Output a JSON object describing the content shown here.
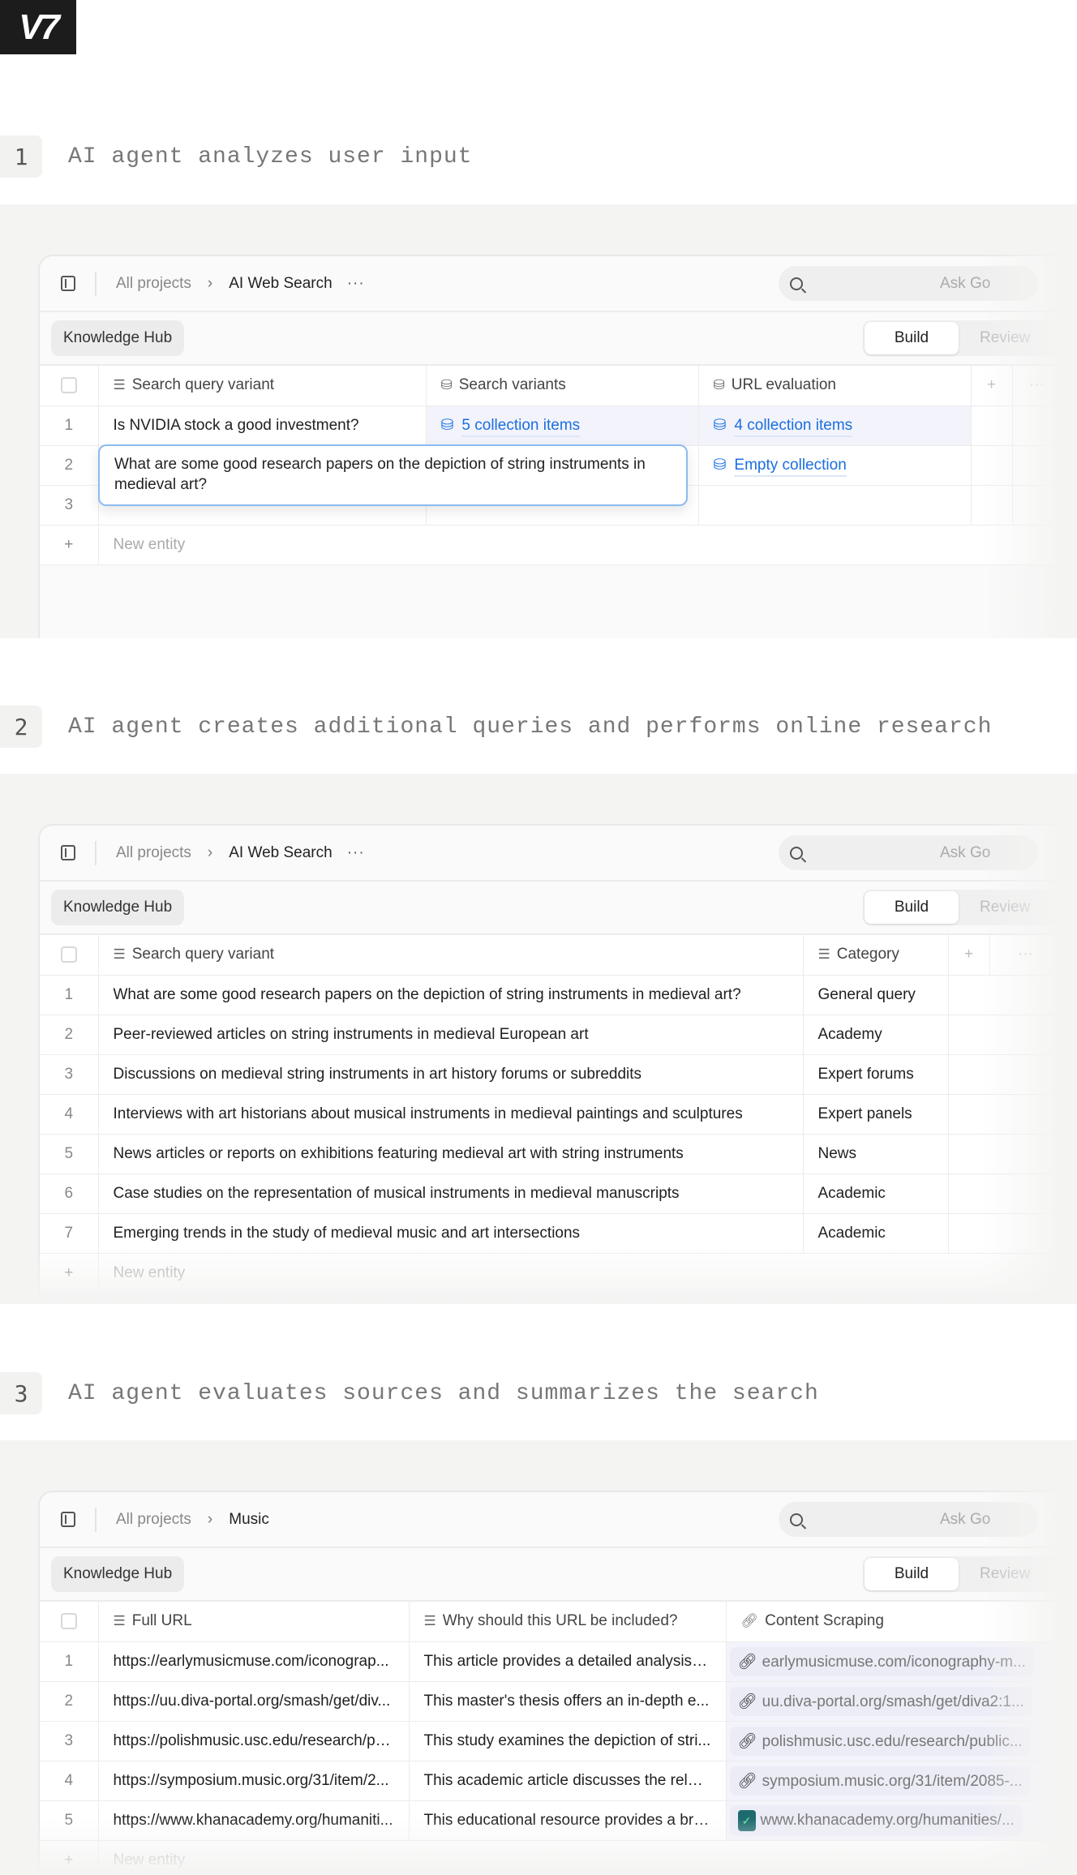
{
  "logo": "V7",
  "common": {
    "all_projects": "All projects",
    "more": "···",
    "ask": "Ask Go",
    "knowledge_hub": "Knowledge Hub",
    "build": "Build",
    "review": "Review",
    "new_entity": "New entity",
    "plus": "+",
    "dots": "···"
  },
  "steps": [
    {
      "num": "1",
      "text": "AI agent analyzes user input"
    },
    {
      "num": "2",
      "text": "AI agent creates additional queries and performs online research"
    },
    {
      "num": "3",
      "text": "AI agent evaluates sources and summarizes the search"
    }
  ],
  "panel1": {
    "project": "AI Web Search",
    "columns": [
      "Search query variant",
      "Search variants",
      "URL evaluation"
    ],
    "rows": [
      {
        "n": "1",
        "query": "Is NVIDIA stock a good investment?",
        "variants": "5 collection items",
        "urls": "4 collection items"
      },
      {
        "n": "2",
        "query": "",
        "variants": "",
        "urls": "Empty collection"
      },
      {
        "n": "3",
        "query": "",
        "variants": "",
        "urls": ""
      }
    ],
    "editing_value": "What are some good research papers on the depiction of string instruments in medieval art?"
  },
  "panel2": {
    "project": "AI Web Search",
    "columns": [
      "Search query variant",
      "Category"
    ],
    "rows": [
      {
        "n": "1",
        "query": "What are some good research papers on the depiction of string instruments in medieval art?",
        "category": "General query"
      },
      {
        "n": "2",
        "query": "Peer-reviewed articles on string instruments in medieval European art",
        "category": "Academy"
      },
      {
        "n": "3",
        "query": "Discussions on medieval string instruments in art history forums or subreddits",
        "category": "Expert forums"
      },
      {
        "n": "4",
        "query": "Interviews with art historians about musical instruments in medieval paintings and sculptures",
        "category": "Expert panels"
      },
      {
        "n": "5",
        "query": "News articles or reports on exhibitions featuring medieval art with string instruments",
        "category": "News"
      },
      {
        "n": "6",
        "query": "Case studies on the representation of musical instruments in medieval manuscripts",
        "category": "Academic"
      },
      {
        "n": "7",
        "query": "Emerging trends in the study of medieval music and art intersections",
        "category": "Academic"
      }
    ]
  },
  "panel3": {
    "project": "Music",
    "columns": [
      "Full URL",
      "Why should this URL be included?",
      "Content Scraping"
    ],
    "rows": [
      {
        "n": "1",
        "url": "https://earlymusicmuse.com/iconograp...",
        "why": "This article provides a detailed analysis o...",
        "scrape": "earlymusicmuse.com/iconography-m...",
        "icon": "link"
      },
      {
        "n": "2",
        "url": "https://uu.diva-portal.org/smash/get/div...",
        "why": "This master's thesis offers an in-depth e...",
        "scrape": "uu.diva-portal.org/smash/get/diva2:1...",
        "icon": "link"
      },
      {
        "n": "3",
        "url": "https://polishmusic.usc.edu/research/pu...",
        "why": "This study examines the depiction of stri...",
        "scrape": "polishmusic.usc.edu/research/public...",
        "icon": "link"
      },
      {
        "n": "4",
        "url": "https://symposium.music.org/31/item/2...",
        "why": "This academic article discusses the relati...",
        "scrape": "symposium.music.org/31/item/2085-...",
        "icon": "link"
      },
      {
        "n": "5",
        "url": "https://www.khanacademy.org/humaniti...",
        "why": "This educational resource provides a bro...",
        "scrape": "www.khanacademy.org/humanities/...",
        "icon": "khan-academy-favicon"
      }
    ]
  },
  "colors": {
    "link": "#1a6fe0",
    "panel_bg": "#f4f4f3",
    "edit_border": "#8bbcf0",
    "highlight": "#f3f3fb"
  }
}
